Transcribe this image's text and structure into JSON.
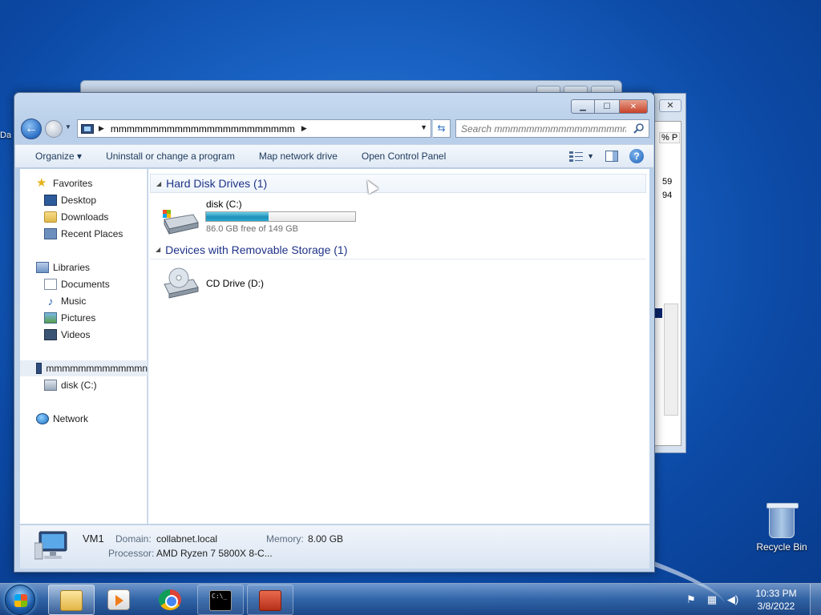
{
  "desktop": {
    "edge_label": "Da",
    "recycle_bin_label": "Recycle Bin"
  },
  "background_window": {
    "column_header": "% P",
    "values": [
      "59",
      "94"
    ],
    "close_glyph": "✕"
  },
  "explorer": {
    "caption_buttons": {
      "minimize": "▁",
      "maximize": "☐",
      "close": "✕"
    },
    "address": {
      "path": "mmmmmmmmmmmmmmmmmmmmmmm",
      "separator": "▶",
      "dropdown": "▼"
    },
    "search": {
      "placeholder": "Search mmmmmmmmmmmmmmmmmmmm..."
    },
    "toolbar": {
      "organize": "Organize ▾",
      "uninstall": "Uninstall or change a program",
      "map_drive": "Map network drive",
      "control_panel": "Open Control Panel",
      "help": "?"
    },
    "nav": {
      "favorites": "Favorites",
      "desktop": "Desktop",
      "downloads": "Downloads",
      "recent_places": "Recent Places",
      "libraries": "Libraries",
      "documents": "Documents",
      "music": "Music",
      "pictures": "Pictures",
      "videos": "Videos",
      "computer": "mmmmmmmmmmmmn",
      "disk_c": "disk (C:)",
      "network": "Network"
    },
    "groups": {
      "hard_disks": "Hard Disk Drives (1)",
      "removable": "Devices with Removable Storage (1)"
    },
    "drives": {
      "c_name": "disk (C:)",
      "c_free": "86.0 GB free of 149 GB",
      "c_used_fraction": 0.42,
      "d_name": "CD Drive (D:)"
    },
    "details": {
      "name": "VM1",
      "domain_label": "Domain:",
      "domain_value": "collabnet.local",
      "memory_label": "Memory:",
      "memory_value": "8.00 GB",
      "processor_label": "Processor:",
      "processor_value": "AMD Ryzen 7 5800X 8-C..."
    }
  },
  "taskbar": {
    "cmd_glyph": "C:\\_",
    "clock_time": "10:33 PM",
    "clock_date": "3/8/2022"
  }
}
